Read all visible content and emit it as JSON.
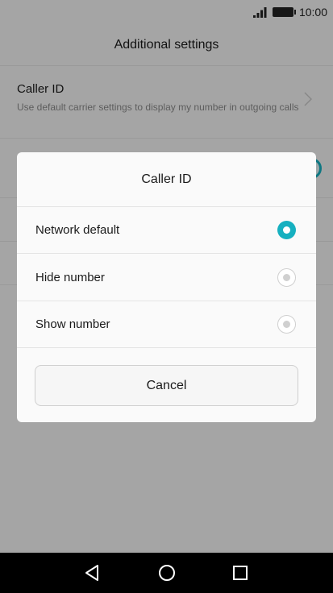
{
  "status_bar": {
    "time": "10:00"
  },
  "screen": {
    "title": "Additional settings"
  },
  "background_settings": {
    "caller_id": {
      "title": "Caller ID",
      "description": "Use default carrier settings to display my number in outgoing calls"
    }
  },
  "dialog": {
    "title": "Caller ID",
    "options": [
      {
        "label": "Network default",
        "selected": true
      },
      {
        "label": "Hide number",
        "selected": false
      },
      {
        "label": "Show number",
        "selected": false
      }
    ],
    "cancel_label": "Cancel"
  },
  "colors": {
    "accent": "#16b0c0",
    "nav_bar": "#000000"
  },
  "icons": [
    "signal-icon",
    "battery-icon",
    "chevron-right-icon",
    "back-icon",
    "home-icon",
    "recents-icon"
  ]
}
